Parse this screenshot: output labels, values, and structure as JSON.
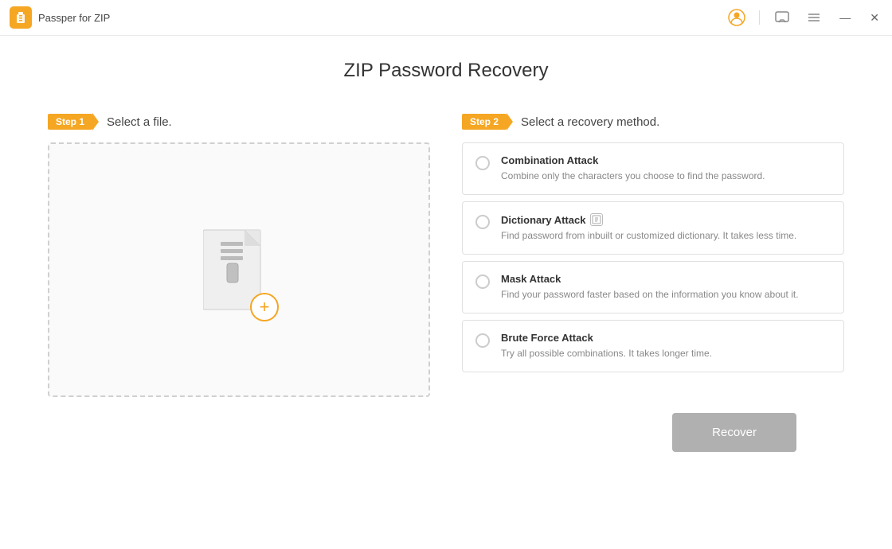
{
  "titleBar": {
    "appName": "Passper for ZIP",
    "icons": {
      "user": "👤",
      "chat": "💬",
      "menu": "☰",
      "minimize": "—",
      "close": "✕"
    }
  },
  "page": {
    "title": "ZIP Password Recovery"
  },
  "step1": {
    "badge": "Step 1",
    "label": "Select a file."
  },
  "step2": {
    "badge": "Step 2",
    "label": "Select a recovery method."
  },
  "recoveryOptions": [
    {
      "id": "combination",
      "title": "Combination Attack",
      "desc": "Combine only the characters you choose to find the password.",
      "hasInfo": false
    },
    {
      "id": "dictionary",
      "title": "Dictionary Attack",
      "desc": "Find password from inbuilt or customized dictionary. It takes less time.",
      "hasInfo": true
    },
    {
      "id": "mask",
      "title": "Mask Attack",
      "desc": "Find your password faster based on the information you know about it.",
      "hasInfo": false
    },
    {
      "id": "bruteforce",
      "title": "Brute Force Attack",
      "desc": "Try all possible combinations. It takes longer time.",
      "hasInfo": false
    }
  ],
  "buttons": {
    "recover": "Recover",
    "addFile": "+"
  }
}
